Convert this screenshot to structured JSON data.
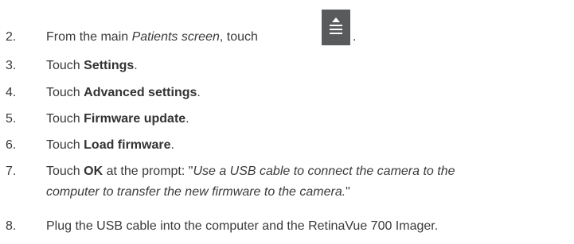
{
  "steps": [
    {
      "num": "2.",
      "pre": "From the main ",
      "italic": "Patients screen",
      "post": ", touch ",
      "end": "."
    },
    {
      "num": "3.",
      "pre": "Touch ",
      "bold": "Settings",
      "post": "."
    },
    {
      "num": "4.",
      "pre": "Touch ",
      "bold": "Advanced settings",
      "post": "."
    },
    {
      "num": "5.",
      "pre": "Touch ",
      "bold": "Firmware update",
      "post": "."
    },
    {
      "num": "6.",
      "pre": "Touch ",
      "bold": "Load firmware",
      "post": "."
    },
    {
      "num": "7.",
      "pre": "Touch ",
      "bold": "OK",
      "post": " at the prompt: \"",
      "italic_line1": "Use a USB cable to connect the camera to the",
      "italic_line2": "computer to transfer the new firmware to the camera.",
      "end": "\""
    },
    {
      "num": "8.",
      "text": "Plug the USB cable into the computer and the RetinaVue 700 Imager."
    }
  ],
  "icons": {
    "menu_button": "eject-menu-icon",
    "menu_button_color": "#585a5c"
  }
}
